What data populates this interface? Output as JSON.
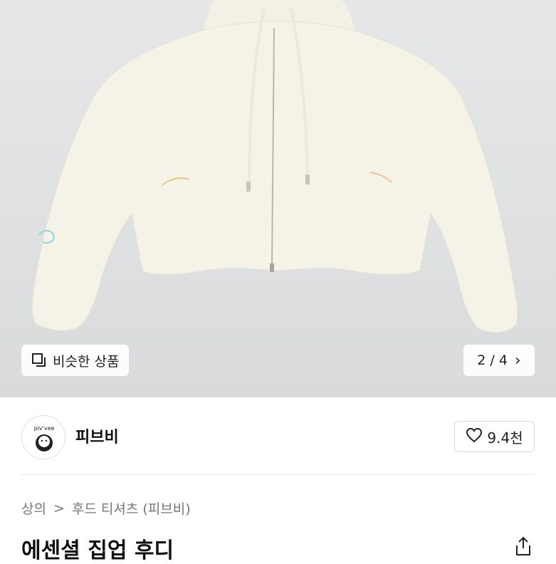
{
  "hero": {
    "similar_label": "비슷한 상품",
    "page_indicator": "2 / 4",
    "chevron": "›"
  },
  "seller": {
    "name": "피브비",
    "avatar_text": "piv'vee",
    "likes": "9.4천"
  },
  "breadcrumb": {
    "category": "상의",
    "separator": ">",
    "subcategory": "후드 티셔츠 (피브비)"
  },
  "product": {
    "title": "에센셜 집업 후디"
  },
  "icons": {
    "similar": "square-stack-icon",
    "like": "heart-icon",
    "share": "share-icon",
    "chevron": "chevron-right-icon"
  }
}
